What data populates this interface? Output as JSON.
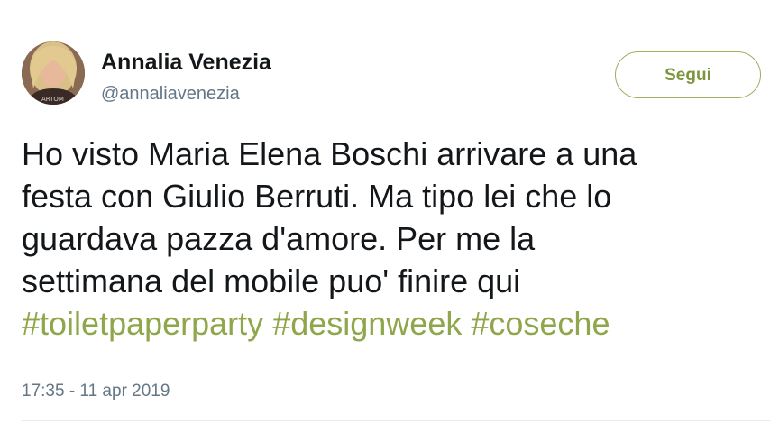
{
  "tweet": {
    "author": {
      "name": "Annalia Venezia",
      "handle": "@annaliavenezia"
    },
    "follow_label": "Segui",
    "text_lines": [
      "Ho visto Maria Elena Boschi arrivare a una",
      "festa con Giulio Berruti. Ma tipo lei che lo",
      "guardava pazza d'amore. Per me la",
      "settimana del mobile puo' finire qui"
    ],
    "hashtags": [
      "#toiletpaperparty",
      "#designweek",
      "#coseche"
    ],
    "timestamp": "17:35 - 11 apr 2019"
  },
  "colors": {
    "accent": "#8fa64a",
    "text": "#14171a",
    "muted": "#657786"
  }
}
